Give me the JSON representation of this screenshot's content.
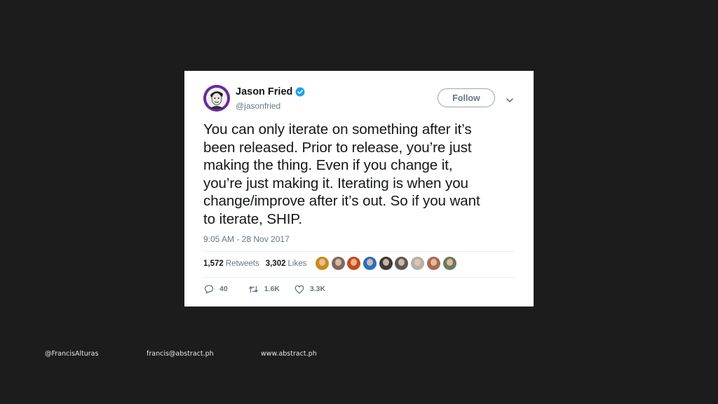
{
  "tweet": {
    "author": {
      "display_name": "Jason Fried",
      "handle": "@jasonfried",
      "verified": true,
      "avatar_color": "#6a2aa0"
    },
    "follow_label": "Follow",
    "text_lines": [
      "You can only iterate on something after it’s",
      "been released. Prior to release, you’re just",
      "making the thing. Even if you change it,",
      "you’re just making it. Iterating is when you",
      "change/improve after it’s out. So if you want",
      "to iterate, SHIP."
    ],
    "timestamp": "9:05 AM - 28 Nov 2017",
    "stats": {
      "retweets_count": "1,572",
      "retweets_label": "Retweets",
      "likes_count": "3,302",
      "likes_label": "Likes"
    },
    "liker_avatar_colors": [
      "#c98a1a",
      "#7a6a60",
      "#c24b1c",
      "#2a6fbf",
      "#3a3a3a",
      "#5a5a5a",
      "#b7b0a8",
      "#a86a50",
      "#6a7a5a"
    ],
    "actions": {
      "reply_count": "40",
      "retweet_count": "1.6K",
      "like_count": "3.3K"
    }
  },
  "footer": {
    "twitter": "@FrancisAlturas",
    "email": "francis@abstract.ph",
    "website": "www.abstract.ph"
  }
}
